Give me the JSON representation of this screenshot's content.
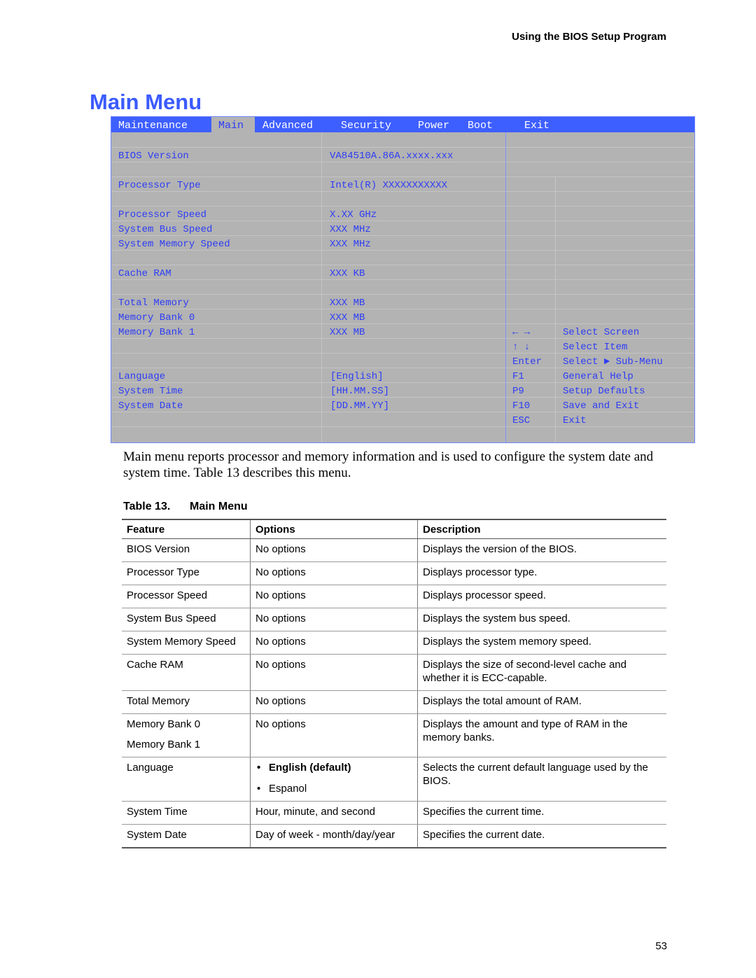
{
  "running_header": "Using the BIOS Setup Program",
  "page_title": "Main Menu",
  "bios": {
    "tabs": [
      {
        "label": "Maintenance",
        "active": false
      },
      {
        "label": "Main",
        "active": true
      },
      {
        "label": "Advanced",
        "active": false
      },
      {
        "label": "Security",
        "active": false
      },
      {
        "label": "Power",
        "active": false
      },
      {
        "label": "Boot",
        "active": false
      },
      {
        "label": "Exit",
        "active": false
      }
    ],
    "items": [
      {
        "label": "BIOS Version",
        "value": "VA84510A.86A.xxxx.xxx"
      },
      {
        "label": "Processor Type",
        "value": "Intel(R) XXXXXXXXXXX"
      },
      {
        "label": "Processor Speed",
        "value": "X.XX GHz"
      },
      {
        "label": "System Bus Speed",
        "value": "XXX MHz"
      },
      {
        "label": "System Memory Speed",
        "value": "XXX MHz"
      },
      {
        "label": "Cache RAM",
        "value": "XXX KB"
      },
      {
        "label": "Total Memory",
        "value": "XXX MB"
      },
      {
        "label": "Memory Bank 0",
        "value": "XXX MB"
      },
      {
        "label": "Memory Bank 1",
        "value": "XXX MB"
      },
      {
        "label": "Language",
        "value": "[English]"
      },
      {
        "label": "System Time",
        "value": "[HH.MM.SS]"
      },
      {
        "label": "System Date",
        "value": "[DD.MM.YY]"
      }
    ],
    "keys": [
      {
        "key": "← →",
        "desc": "Select Screen"
      },
      {
        "key": "↑ ↓",
        "desc": "Select Item"
      },
      {
        "key": "Enter",
        "desc": "Select ► Sub-Menu"
      },
      {
        "key": "F1",
        "desc": "General Help"
      },
      {
        "key": "P9",
        "desc": "Setup Defaults"
      },
      {
        "key": "F10",
        "desc": "Save and Exit"
      },
      {
        "key": "ESC",
        "desc": "Exit"
      }
    ]
  },
  "intro_text": "Main menu reports processor and memory information and is used to configure the system date and system time.  Table 13 describes this menu.",
  "table": {
    "caption_number": "Table 13.",
    "caption_title": "Main Menu",
    "headers": [
      "Feature",
      "Options",
      "Description"
    ],
    "rows": [
      {
        "feature": "BIOS Version",
        "options": "No options",
        "description": "Displays the version of the BIOS."
      },
      {
        "feature": "Processor Type",
        "options": "No options",
        "description": "Displays processor type."
      },
      {
        "feature": "Processor Speed",
        "options": "No options",
        "description": "Displays processor speed."
      },
      {
        "feature": "System Bus Speed",
        "options": "No options",
        "description": "Displays the system bus speed."
      },
      {
        "feature": "System Memory Speed",
        "options": "No options",
        "description": "Displays the system memory speed."
      },
      {
        "feature": "Cache RAM",
        "options": "No options",
        "description": "Displays the size of second-level cache and whether it is ECC-capable."
      },
      {
        "feature": "Total Memory",
        "options": "No options",
        "description": "Displays the total amount of RAM."
      },
      {
        "feature_lines": [
          "Memory Bank 0",
          "Memory Bank 1"
        ],
        "options": "No options",
        "description": "Displays the amount and type of RAM in the memory banks."
      },
      {
        "feature": "Language",
        "option_list": [
          "English (default)",
          "Espanol"
        ],
        "description": "Selects the current default language used by the BIOS."
      },
      {
        "feature": "System Time",
        "options": "Hour, minute, and second",
        "description": "Specifies the current time."
      },
      {
        "feature": "System Date",
        "options": "Day of week - month/day/year",
        "description": "Specifies the current date."
      }
    ]
  },
  "page_number": "53",
  "colors": {
    "title_blue": "#3b5bff",
    "bios_tab_bar": "#3e5fff",
    "bios_background": "#b3b3b3",
    "bios_text": "#2d3cf5"
  }
}
